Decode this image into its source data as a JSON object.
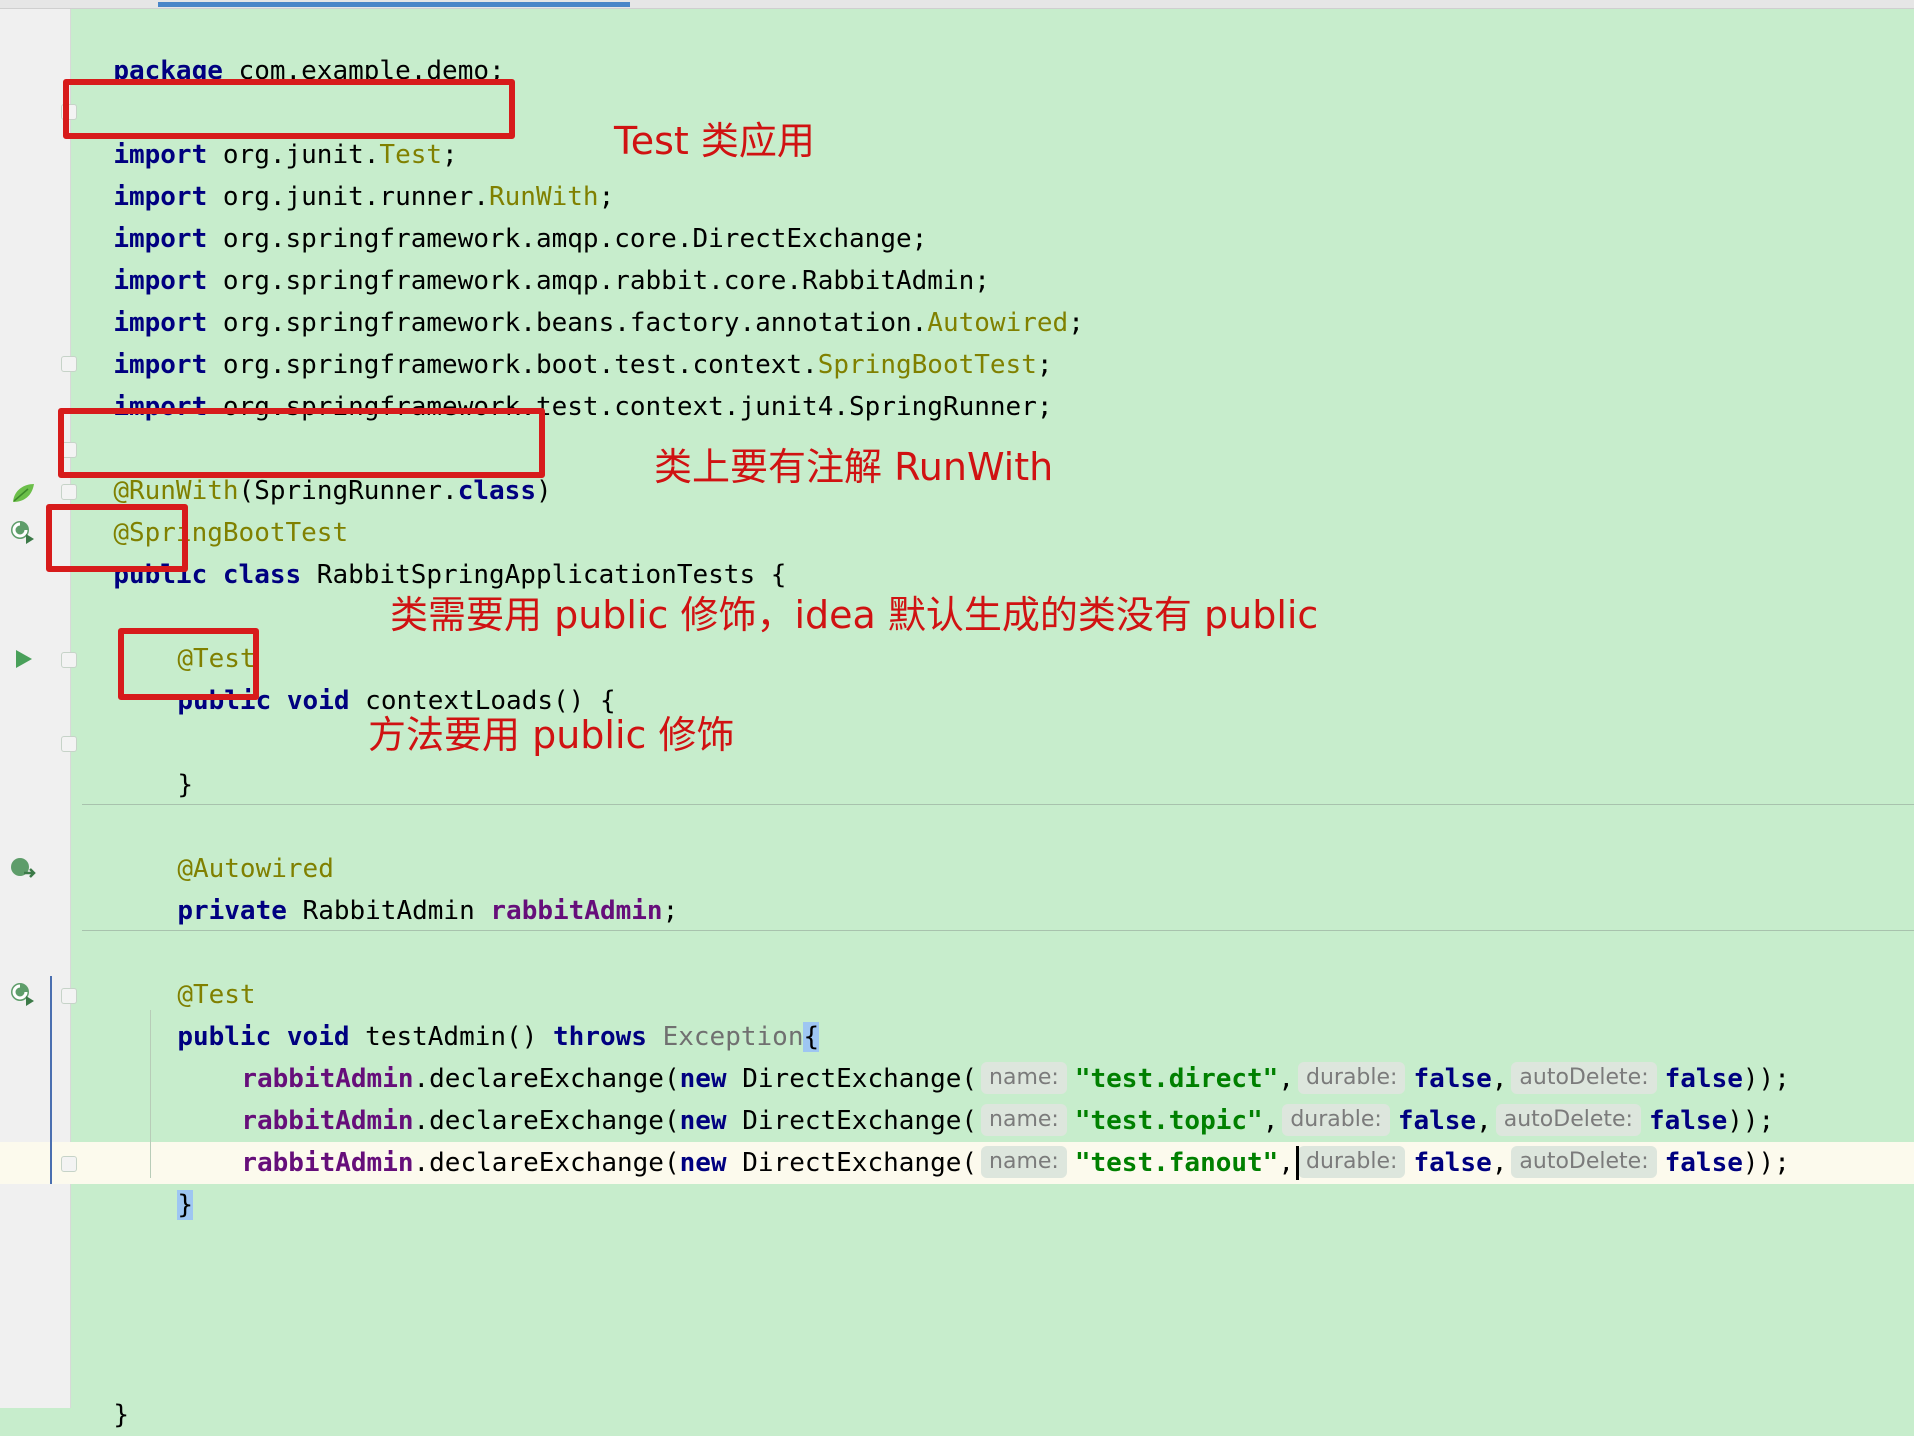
{
  "editor": {
    "package_kw": "package",
    "package_name": " com.example.demo;",
    "imports": [
      {
        "kw": "import",
        "prefix": " org.junit.",
        "cls": "Test",
        "suffix": ";"
      },
      {
        "kw": "import",
        "prefix": " org.junit.runner.",
        "cls": "RunWith",
        "suffix": ";"
      },
      {
        "kw": "import",
        "prefix": " org.springframework.amqp.core.DirectExchange;",
        "cls": "",
        "suffix": ""
      },
      {
        "kw": "import",
        "prefix": " org.springframework.amqp.rabbit.core.RabbitAdmin;",
        "cls": "",
        "suffix": ""
      },
      {
        "kw": "import",
        "prefix": " org.springframework.beans.factory.annotation.",
        "cls": "Autowired",
        "suffix": ";"
      },
      {
        "kw": "import",
        "prefix": " org.springframework.boot.test.context.",
        "cls": "SpringBootTest",
        "suffix": ";"
      },
      {
        "kw": "import",
        "prefix": " org.springframework.test.context.junit4.SpringRunner;",
        "cls": "",
        "suffix": ""
      }
    ],
    "runwith_ann": "@RunWith",
    "runwith_arg_open": "(SpringRunner.",
    "runwith_class_kw": "class",
    "runwith_close": ")",
    "springboottest_ann": "@SpringBootTest",
    "public_kw": "public",
    "class_kw": " class",
    "class_name": " RabbitSpringApplicationTests {",
    "test_ann": "@Test",
    "method1_public": "public",
    "method1_void": " void",
    "method1_name": " contextLoads() {",
    "method1_close": "}",
    "autowired_ann": "@Autowired",
    "private_kw": "private",
    "field_type": " RabbitAdmin ",
    "field_name": "rabbitAdmin",
    "field_semicolon": ";",
    "test_ann2": "@Test",
    "m2_public": "public",
    "m2_void": " void",
    "m2_name": " testAdmin() ",
    "m2_throws": "throws",
    "m2_exception": " Exception",
    "m2_brace": "{",
    "calls": [
      {
        "field": "rabbitAdmin",
        "method": ".declareExchange(",
        "new_kw": "new",
        "ctor": " DirectExchange(",
        "hint_name": "name:",
        "str": "\"test.direct\"",
        "comma1": ",",
        "hint_durable": "durable:",
        "durable": "false",
        "comma2": ",",
        "hint_auto": "autoDelete:",
        "auto": "false",
        "end": "));"
      },
      {
        "field": "rabbitAdmin",
        "method": ".declareExchange(",
        "new_kw": "new",
        "ctor": " DirectExchange(",
        "hint_name": "name:",
        "str": "\"test.topic\"",
        "comma1": ",",
        "hint_durable": "durable:",
        "durable": "false",
        "comma2": ",",
        "hint_auto": "autoDelete:",
        "auto": "false",
        "end": "));"
      },
      {
        "field": "rabbitAdmin",
        "method": ".declareExchange(",
        "new_kw": "new",
        "ctor": " DirectExchange(",
        "hint_name": "name:",
        "str": "\"test.fanout\"",
        "comma1": ",",
        "hint_durable": "durable:",
        "durable": "false",
        "comma2": ",",
        "hint_auto": "autoDelete:",
        "auto": "false",
        "end": "));"
      }
    ],
    "m2_close": "}",
    "class_close": "}"
  },
  "annotations": {
    "note1": "Test 类应用",
    "note2": "类上要有注解 RunWith",
    "note3": "类需要用 public 修饰，idea 默认生成的类没有 public",
    "note4": "方法要用 public 修饰"
  },
  "colors": {
    "background": "#c7edcc",
    "annotation_red": "#d71b1b",
    "keyword": "#000080",
    "annotation": "#808000",
    "field": "#660e7a",
    "string": "#008000"
  }
}
